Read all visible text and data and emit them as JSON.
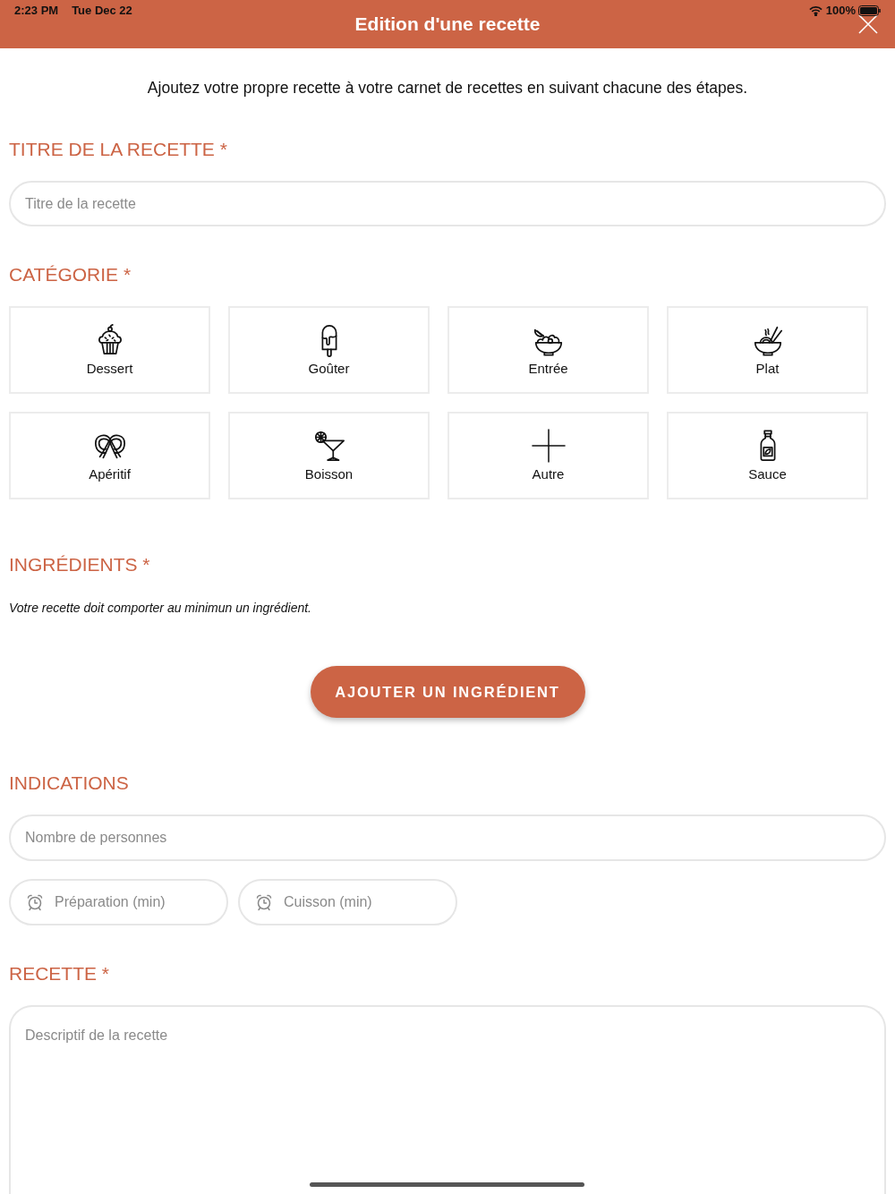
{
  "status_bar": {
    "time": "2:23 PM",
    "date": "Tue Dec 22",
    "battery": "100%"
  },
  "header": {
    "title": "Edition d'une recette"
  },
  "intro": "Ajoutez votre propre recette à votre carnet de recettes en suivant chacune des étapes.",
  "title_section": {
    "heading": "TITRE DE LA RECETTE *",
    "field": {
      "placeholder": "Titre de la recette"
    }
  },
  "category_section": {
    "heading": "CATÉGORIE *",
    "categories": [
      {
        "label": "Dessert",
        "selected": false
      },
      {
        "label": "Goûter",
        "selected": false
      },
      {
        "label": "Entrée",
        "selected": false
      },
      {
        "label": "Plat",
        "selected": false
      },
      {
        "label": "Apéritif",
        "selected": false
      },
      {
        "label": "Boisson",
        "selected": false
      },
      {
        "label": "Autre",
        "selected": false
      },
      {
        "label": "Sauce",
        "selected": false
      }
    ]
  },
  "ingredients_section": {
    "heading": "INGRÉDIENTS *",
    "note": "Votre recette doit comporter au minimun un ingrédient.",
    "add_button": "AJOUTER UN INGRÉDIENT"
  },
  "indications_section": {
    "heading": "INDICATIONS",
    "servings_field": {
      "placeholder": "Nombre de personnes"
    },
    "time_fields": [
      {
        "placeholder": "Préparation (min)"
      },
      {
        "placeholder": "Cuisson (min)"
      }
    ]
  },
  "recipe_section": {
    "heading": "RECETTE *",
    "description_field": {
      "placeholder": "Descriptif de la recette"
    }
  }
}
